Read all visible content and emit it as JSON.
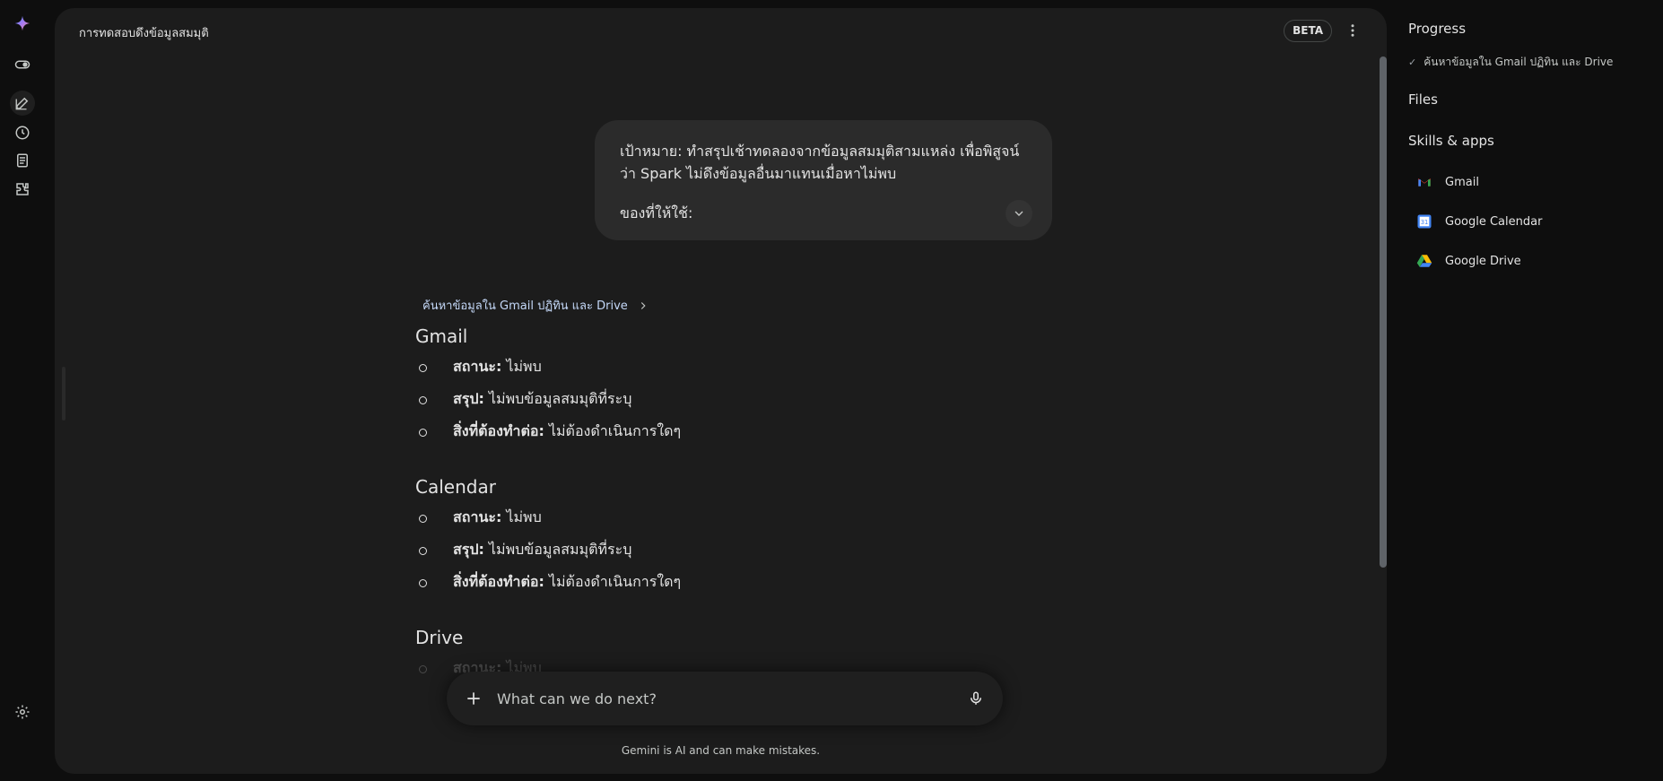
{
  "header": {
    "title": "การทดสอบดึงข้อมูลสมมุติ",
    "beta_label": "BETA"
  },
  "prompt": {
    "text": "เป้าหมาย: ทำสรุปเช้าทดลองจากข้อมูลสมมุติสามแหล่ง เพื่อพิสูจน์ว่า Spark ไม่ดึงข้อมูลอื่นมาแทนเมื่อหาไม่พบ",
    "sub": "ของที่ให้ใช้:"
  },
  "response": {
    "progress_link": "ค้นหาข้อมูลใน Gmail ปฏิทิน และ Drive",
    "sections": [
      {
        "title": "Gmail",
        "items": [
          {
            "label": "สถานะ:",
            "value": " ไม่พบ"
          },
          {
            "label": "สรุป:",
            "value": " ไม่พบข้อมูลสมมุติที่ระบุ"
          },
          {
            "label": "สิ่งที่ต้องทำต่อ:",
            "value": " ไม่ต้องดำเนินการใดๆ"
          }
        ]
      },
      {
        "title": "Calendar",
        "items": [
          {
            "label": "สถานะ:",
            "value": " ไม่พบ"
          },
          {
            "label": "สรุป:",
            "value": " ไม่พบข้อมูลสมมุติที่ระบุ"
          },
          {
            "label": "สิ่งที่ต้องทำต่อ:",
            "value": " ไม่ต้องดำเนินการใดๆ"
          }
        ]
      },
      {
        "title": "Drive",
        "items": [
          {
            "label": "สถานะ:",
            "value": " ไม่พบ"
          }
        ]
      }
    ]
  },
  "composer": {
    "placeholder": "What can we do next?"
  },
  "disclaimer": "Gemini is AI and can make mistakes.",
  "side": {
    "progress_title": "Progress",
    "progress_step": "ค้นหาข้อมูลใน Gmail ปฏิทิน และ Drive",
    "files_title": "Files",
    "skills_title": "Skills & apps",
    "apps": [
      "Gmail",
      "Google Calendar",
      "Google Drive"
    ]
  },
  "colors": {
    "background": "#0e0e0e",
    "panel": "#1c1c1c",
    "bubble": "#2b2b2b",
    "link": "#a8c7fa"
  },
  "icons": {
    "rail": [
      "gemini-spark-icon",
      "toggle-icon",
      "edit-icon",
      "history-icon",
      "notebook-icon",
      "extension-icon",
      "settings-icon"
    ]
  }
}
